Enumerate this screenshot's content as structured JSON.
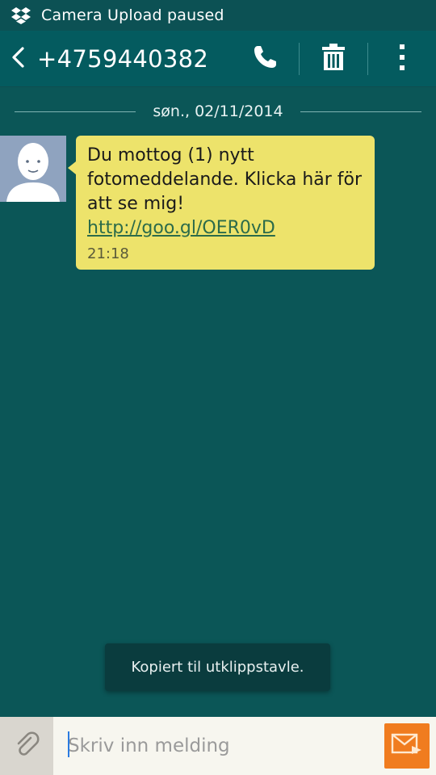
{
  "status_bar": {
    "notification_icon": "dropbox-icon",
    "text": "Camera Upload paused"
  },
  "action_bar": {
    "contact": "+4759440382",
    "icons": [
      "back-icon",
      "phone-icon",
      "trash-icon",
      "overflow-menu-icon"
    ]
  },
  "thread": {
    "date": "søn., 02/11/2014",
    "messages": [
      {
        "text": "Du mottog (1) nytt fotomeddelande. Klicka här för att se mig! ",
        "link": "http://goo.gl/OER0vD",
        "time": "21:18"
      }
    ]
  },
  "toast": {
    "text": "Kopiert til utklippstavle."
  },
  "compose": {
    "placeholder": "Skriv inn melding",
    "icons": [
      "paperclip-icon",
      "send-icon"
    ]
  },
  "colors": {
    "background": "#0b5657",
    "action_bar": "#045b5f",
    "bubble": "#ede36b",
    "send_button": "#f07c1f"
  }
}
